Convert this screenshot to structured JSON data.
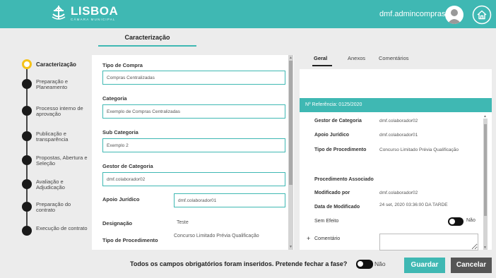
{
  "header": {
    "logo_title": "LISBOA",
    "logo_subtitle": "CÂMARA MUNICIPAL",
    "user_name": "dmf.admincompras |"
  },
  "top_tab": {
    "label": "Caracterização"
  },
  "stepper": {
    "steps": [
      {
        "label": "Caracterização",
        "active": true
      },
      {
        "label": "Preparação e Planeamento"
      },
      {
        "label": "Processo interno de aprovação"
      },
      {
        "label": "Publicação e transparência"
      },
      {
        "label": "Propostas, Abertura e Seleção"
      },
      {
        "label": "Avaliação e Adjudicação"
      },
      {
        "label": "Preparação do contrato"
      },
      {
        "label": "Execução de contrato"
      }
    ]
  },
  "form": {
    "tipo_compra_label": "Tipo de Compra",
    "tipo_compra_value": "Compras Centralizadas",
    "categoria_label": "Categoria",
    "categoria_value": "Exemplo de Compras Centralizadas",
    "sub_categoria_label": "Sub Categoria",
    "sub_categoria_value": "Exemplo 2",
    "gestor_label": "Gestor de Categoria",
    "gestor_value": "dmf.colaborador02",
    "apoio_label": "Apoio Jurídico",
    "apoio_value": "dmf.colaborador01",
    "designacao_label": "Designação",
    "designacao_value": "Teste",
    "tipo_proc_label": "Tipo de Procedimento",
    "tipo_proc_value": "Concurso Limitado Prévia Qualificação"
  },
  "right_tabs": {
    "geral": "Geral",
    "anexos": "Anexos",
    "comentarios": "Comentários"
  },
  "details": {
    "ref": "Nº Referência: 0125/2020",
    "gestor_label": "Gestor de Categoria",
    "gestor_value": "dmf.colaborador02",
    "apoio_label": "Apoio Jurídico",
    "apoio_value": "dmf.colaborador01",
    "tipo_proc_label": "Tipo de Procedimento",
    "tipo_proc_value": "Concurso Limitado Prévia Qualificação",
    "proc_assoc_label": "Procedimento Associado",
    "modificado_label": "Modificado por",
    "modificado_value": "dmf.colaborador02",
    "data_label": "Data de Modificado",
    "data_value": "24 set, 2020 03:36:00 DA TARDE",
    "sem_efeito_label": "Sem Efeito",
    "sem_efeito_toggle": "Não",
    "comentario_plus": "+",
    "comentario_label": "Comentário"
  },
  "footer": {
    "question": "Todos os campos obrigatórios foram inseridos. Pretende fechar a fase?",
    "toggle_label": "Não",
    "save_label": "Guardar",
    "cancel_label": "Cancelar"
  },
  "colors": {
    "accent": "#3fb8b3",
    "active_step": "#f5c21a",
    "cancel": "#555555"
  }
}
